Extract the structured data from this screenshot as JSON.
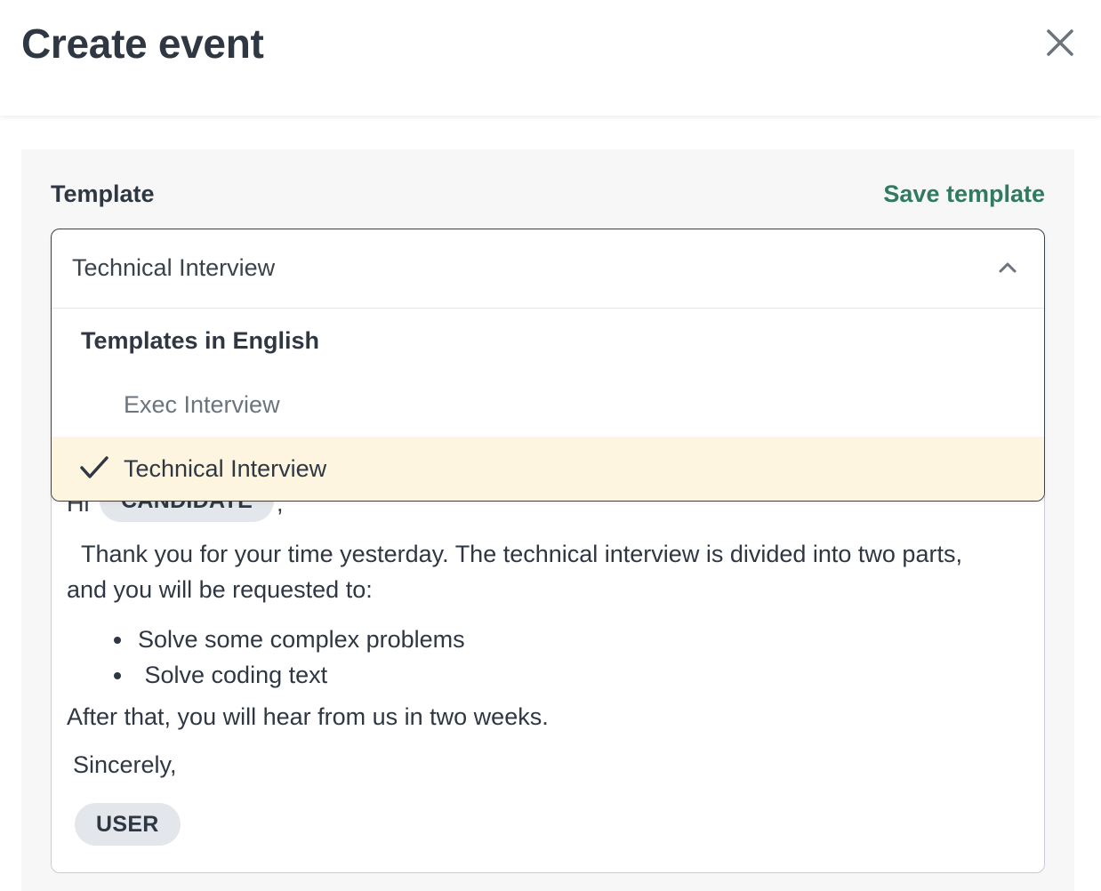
{
  "header": {
    "title": "Create event",
    "close_icon": "close-icon"
  },
  "template": {
    "label": "Template",
    "save_label": "Save template",
    "selected_value": "Technical Interview",
    "chevron_icon": "chevron-up-icon",
    "group_label": "Templates in English",
    "options": [
      {
        "label": "Exec Interview",
        "selected": false
      },
      {
        "label": "Technical Interview",
        "selected": true
      }
    ]
  },
  "editor": {
    "greeting_prefix": "Hi",
    "candidate_chip": "CANDIDATE",
    "greeting_suffix": ",",
    "paragraph": "Thank you for your time yesterday. The technical interview is divided into two parts, and you will be requested to:",
    "bullets": [
      "Solve some complex problems",
      " Solve coding text"
    ],
    "after_text": "After that, you will hear from us in two weeks.",
    "closing": "Sincerely,",
    "user_chip": "USER"
  },
  "colors": {
    "accent_green": "#2f7a61",
    "highlight_option": "#fdf5df",
    "text_dark": "#2f3742",
    "text_muted": "#6b737d",
    "chip_bg": "#e3e6ea",
    "panel_bg": "#f7f7f7"
  }
}
